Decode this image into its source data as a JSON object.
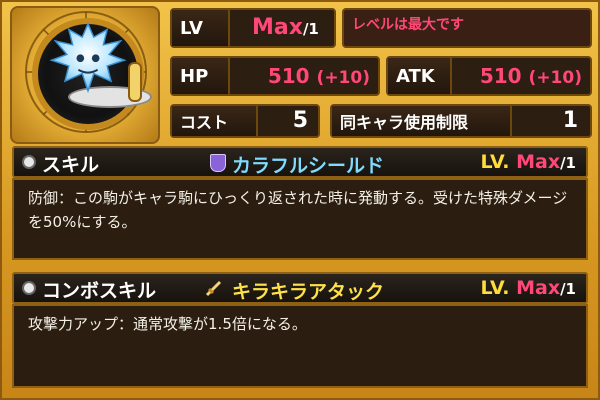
{
  "stats": {
    "lv_label": "LV",
    "lv_value": "Max",
    "lv_slash": "/1",
    "lv_notice": "レベルは最大です",
    "hp_label": "HP",
    "hp_value": "510",
    "hp_bonus": "(+10)",
    "atk_label": "ATK",
    "atk_value": "510",
    "atk_bonus": "(+10)",
    "cost_label": "コスト",
    "cost_value": "5",
    "limit_label": "同キャラ使用制限",
    "limit_value": "1"
  },
  "skill": {
    "section_label": "スキル",
    "name": "カラフルシールド",
    "lv_prefix": "LV.",
    "lv_value": "Max",
    "lv_slash": "/1",
    "description": "防御：この駒がキャラ駒にひっくり返された時に発動する。受けた特殊ダメージを50%にする。"
  },
  "combo": {
    "section_label": "コンボスキル",
    "name": "キラキラアタック",
    "lv_prefix": "LV.",
    "lv_value": "Max",
    "lv_slash": "/1",
    "description": "攻撃力アップ：通常攻撃が1.5倍になる。"
  },
  "colors": {
    "gold_frame": "#e2ad31",
    "panel_dark": "#2d1e12",
    "value_pink": "#ff4778",
    "skill_name_cyan": "#7fdcff",
    "combo_name_yellow": "#ffe14a"
  },
  "icons": {
    "skill_bullet": "circle-bullet-icon",
    "skill_badge": "shield-icon",
    "combo_bullet": "combo-bullet-icon",
    "combo_badge": "sword-icon",
    "character": "crystal-dragon-icon"
  }
}
